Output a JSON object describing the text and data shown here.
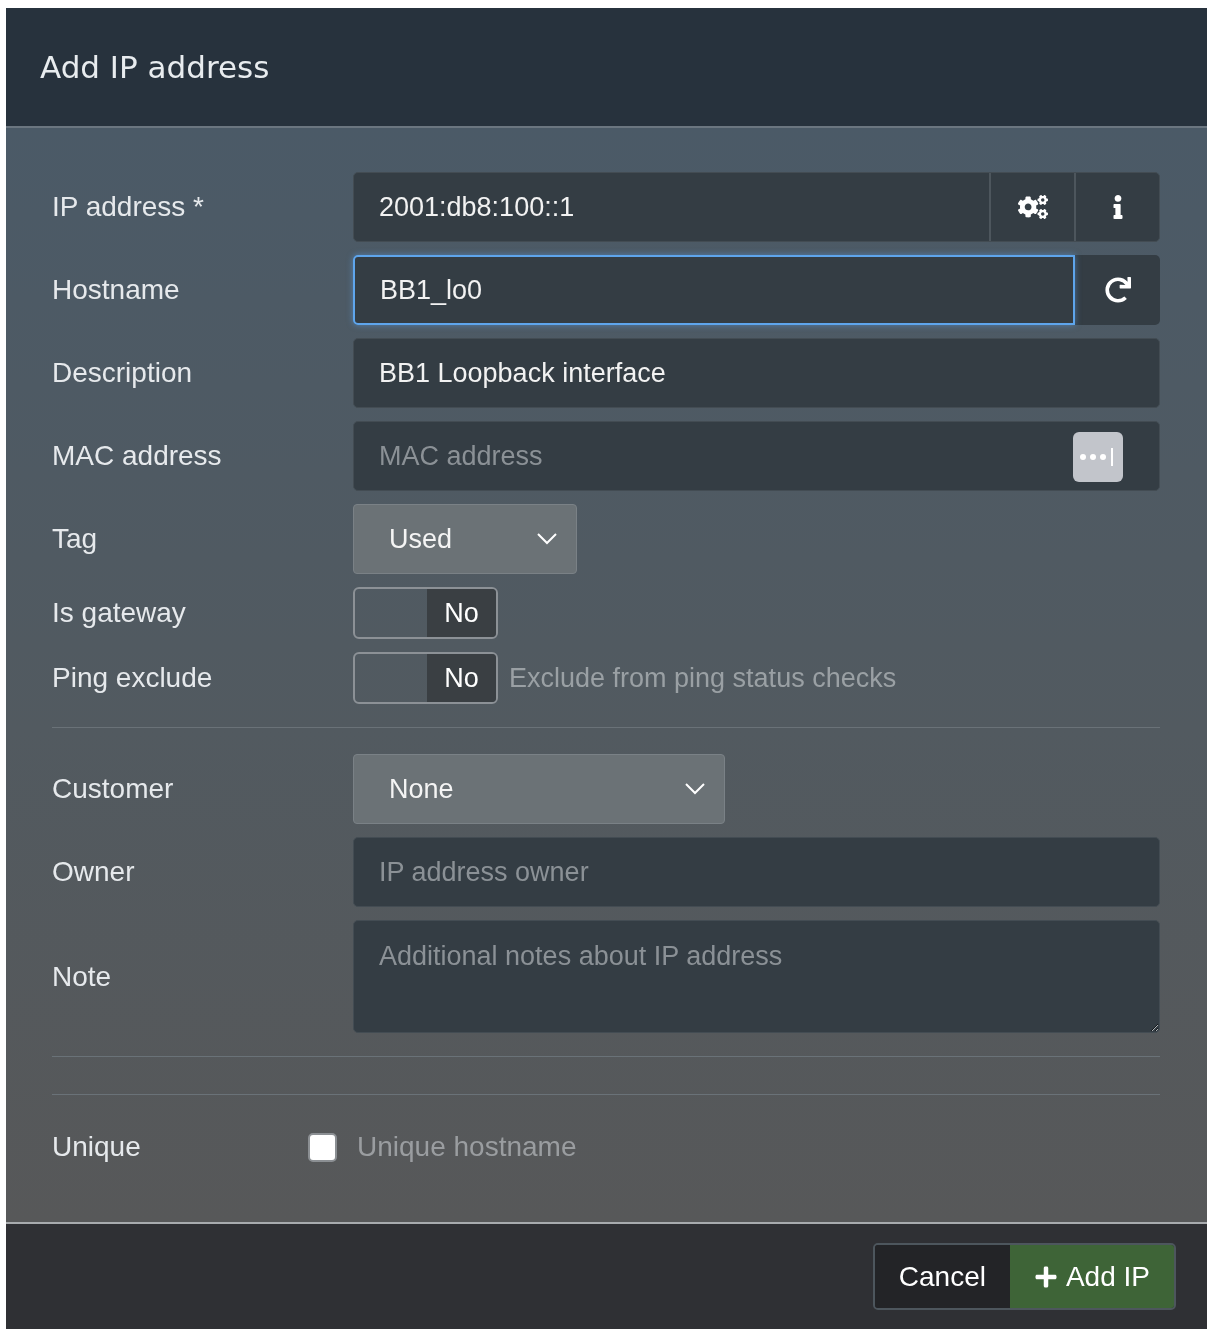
{
  "dialog": {
    "title": "Add IP address"
  },
  "sections": [
    [
      {
        "kind": "ip",
        "label": "IP address *",
        "value": "2001:db8:100::1",
        "focused": false
      },
      {
        "kind": "hostname",
        "label": "Hostname",
        "value": "BB1_lo0",
        "focused": true
      },
      {
        "kind": "text",
        "label": "Description",
        "value": "BB1 Loopback interface",
        "focused": false
      },
      {
        "kind": "mac",
        "label": "MAC address",
        "placeholder": "MAC address",
        "focused": false
      },
      {
        "kind": "select",
        "label": "Tag",
        "value": "Used"
      },
      {
        "kind": "switch",
        "label": "Is gateway",
        "on": false,
        "state_text": "No"
      },
      {
        "kind": "switch",
        "label": "Ping exclude",
        "on": false,
        "state_text": "No",
        "hint": "Exclude from ping status checks"
      }
    ],
    [
      {
        "kind": "select",
        "label": "Customer",
        "value": "None"
      },
      {
        "kind": "text",
        "label": "Owner",
        "placeholder": "IP address owner",
        "focused": false
      },
      {
        "kind": "textarea",
        "label": "Note",
        "placeholder": "Additional notes about IP address"
      }
    ],
    [
      {
        "kind": "checkbox",
        "label": "Unique",
        "checked": false,
        "text": "Unique hostname"
      }
    ]
  ],
  "buttons": [
    {
      "label": "Cancel",
      "kind": "default"
    },
    {
      "label": "Add IP",
      "kind": "primary"
    }
  ]
}
